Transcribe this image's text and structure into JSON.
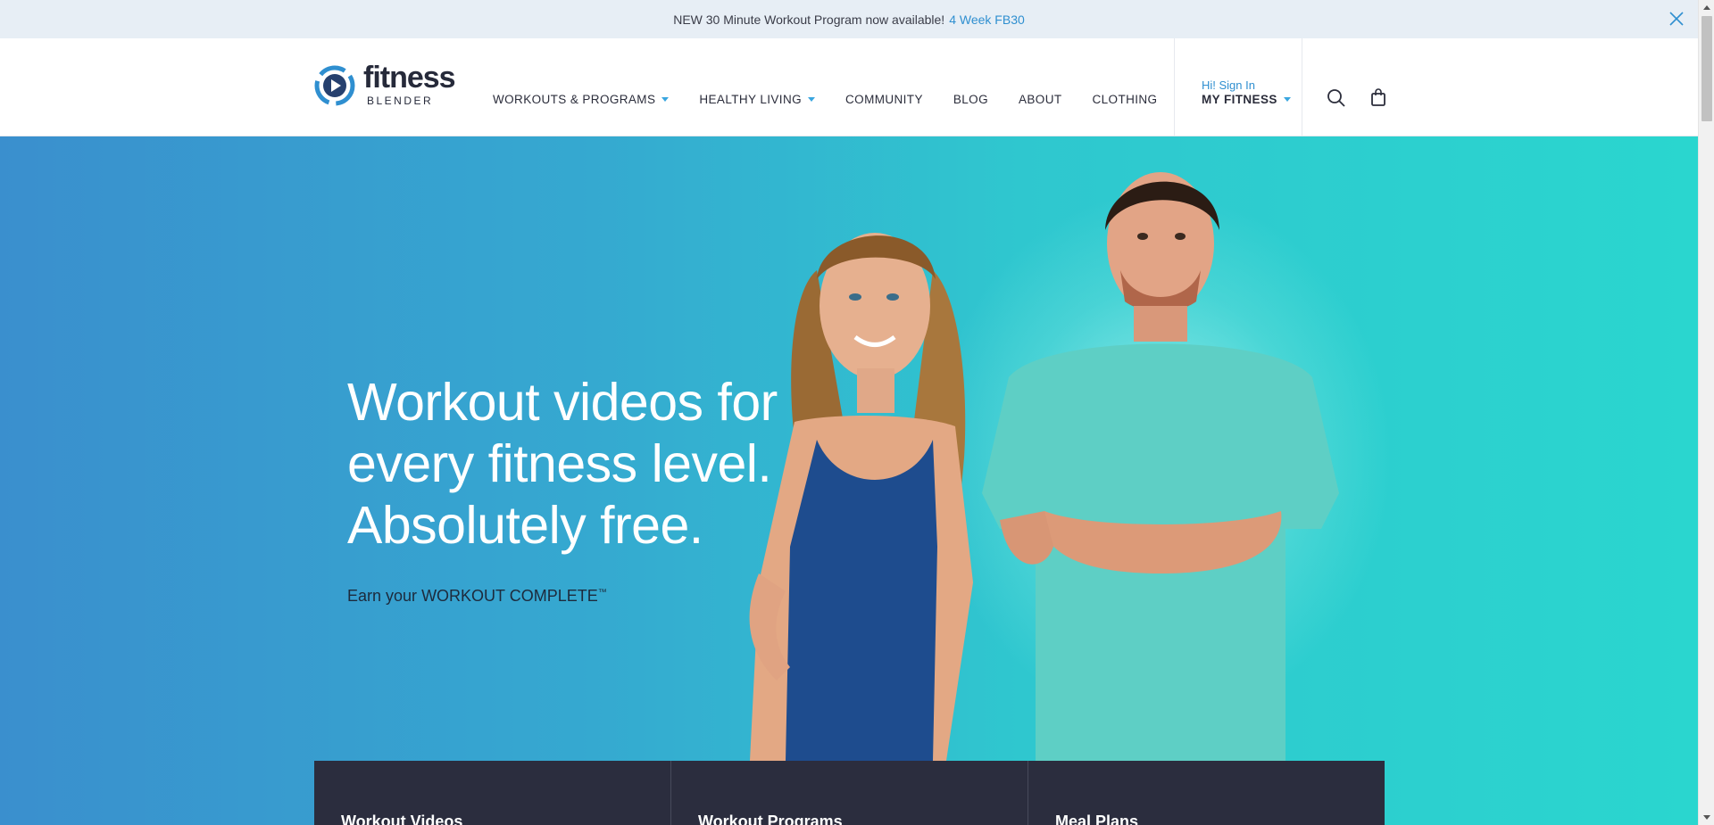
{
  "announcement": {
    "text": "NEW 30 Minute Workout Program now available!",
    "link": "4 Week FB30"
  },
  "logo": {
    "word": "fitness",
    "sub": "BLENDER"
  },
  "nav": {
    "items": [
      {
        "label": "WORKOUTS & PROGRAMS",
        "dropdown": true
      },
      {
        "label": "HEALTHY LIVING",
        "dropdown": true
      },
      {
        "label": "COMMUNITY",
        "dropdown": false
      },
      {
        "label": "BLOG",
        "dropdown": false
      },
      {
        "label": "ABOUT",
        "dropdown": false
      },
      {
        "label": "CLOTHING",
        "dropdown": false
      }
    ]
  },
  "account": {
    "greeting": "Hi! Sign In",
    "label": "MY FITNESS"
  },
  "icons": {
    "search": "search-icon",
    "cart": "shopping-bag-icon",
    "close": "close-icon"
  },
  "hero": {
    "line1": "Workout videos for",
    "line2": "every fitness level.",
    "line3": "Absolutely free.",
    "tagline_prefix": "Earn your",
    "tagline_emph": "WORKOUT COMPLETE",
    "tagline_mark": "™"
  },
  "cards": [
    {
      "label": "Workout Videos"
    },
    {
      "label": "Workout Programs"
    },
    {
      "label": "Meal Plans"
    }
  ],
  "colors": {
    "accent": "#2f8fd0",
    "caret": "#3aa6df",
    "card_bg": "#2b2d3e",
    "announce_bg": "#e7eef5"
  }
}
